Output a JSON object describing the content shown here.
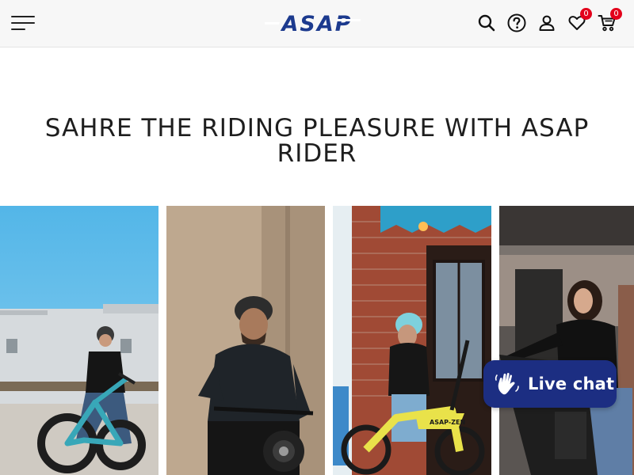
{
  "header": {
    "logo_text": "ASAP",
    "icons": [
      "menu-icon",
      "search-icon",
      "help-icon",
      "account-icon",
      "wishlist-icon",
      "cart-icon"
    ],
    "wishlist_count": "0",
    "cart_count": "0"
  },
  "hero": {
    "title": "SAHRE THE RIDING PLEASURE WITH ASAP RIDER"
  },
  "gallery": {
    "tiles": [
      {
        "subject": "woman-on-teal-fat-tire-ebike"
      },
      {
        "subject": "man-in-helmet-on-black-ebike"
      },
      {
        "subject": "woman-with-yellow-folding-ebike"
      },
      {
        "subject": "woman-with-black-ebike-on-porch"
      }
    ],
    "bike_decal": "ASAP-ZEN"
  },
  "chat": {
    "label": "Live chat"
  },
  "colors": {
    "brand_blue": "#1c2e82",
    "badge_red": "#e3001b",
    "header_bg": "#f7f7f7"
  }
}
